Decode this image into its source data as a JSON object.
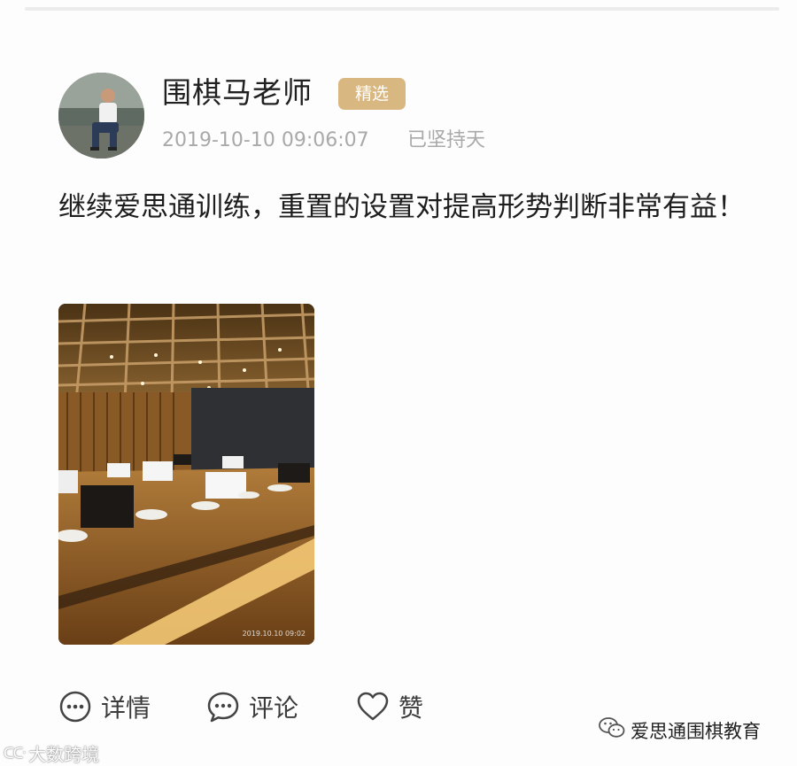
{
  "post": {
    "author": "围棋马老师",
    "badge": "精选",
    "timestamp": "2019-10-10 09:06:07",
    "streak": "已坚持天",
    "text": "继续爱思通训练，重置的设置对提高形势判断非常有益！",
    "photo_stamp": "2019.10.10 09:02"
  },
  "actions": {
    "details": "详情",
    "comment": "评论",
    "like": "赞"
  },
  "watermarks": {
    "left": "大数跨境",
    "right": "爱思通围棋教育"
  },
  "icons": {
    "details": "more-dots-circle-icon",
    "comment": "comment-bubble-icon",
    "like": "heart-outline-icon",
    "wechat": "wechat-icon"
  },
  "colors": {
    "badge": "#d9b781",
    "meta_text": "#a9a9a9",
    "primary_text": "#1e1e1e"
  }
}
